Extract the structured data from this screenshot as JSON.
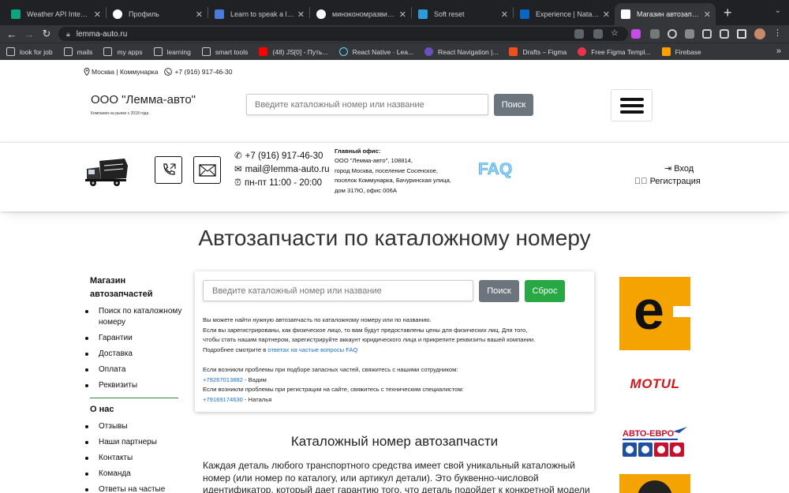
{
  "browser": {
    "tabs": [
      {
        "title": "Weather API Integratio",
        "color": "#10a37f"
      },
      {
        "title": "Профиль",
        "color": "#ffffff"
      },
      {
        "title": "Learn to speak a langu",
        "color": "#4a7bd8"
      },
      {
        "title": "минэкономразвития",
        "color": "#ffffff"
      },
      {
        "title": "Soft reset",
        "color": "#2d9bd9"
      },
      {
        "title": "Experience | Nataly Bi",
        "color": "#0a66c2"
      },
      {
        "title": "Магазин автозапчаст",
        "color": "#ffffff"
      }
    ],
    "url": "lemma-auto.ru",
    "bookmarks": [
      {
        "label": "look for job",
        "icon": "folder-icon"
      },
      {
        "label": "mails",
        "icon": "folder-icon"
      },
      {
        "label": "my apps",
        "icon": "folder-icon"
      },
      {
        "label": "learning",
        "icon": "folder-icon"
      },
      {
        "label": "smart tools",
        "icon": "folder-icon"
      },
      {
        "label": "(48) JS[0] - Путь...",
        "icon": "youtube-icon"
      },
      {
        "label": "React Native · Lea...",
        "icon": "react-icon"
      },
      {
        "label": "React Navigation |...",
        "icon": "react-navigation-icon"
      },
      {
        "label": "Drafts – Figma",
        "icon": "figma-icon"
      },
      {
        "label": "Free Figma Templ...",
        "icon": "figma-icon"
      },
      {
        "label": "Firebase",
        "icon": "firebase-icon"
      }
    ]
  },
  "header": {
    "location": "Москва | Коммунарка",
    "phone": "+7 (916) 917-46-30",
    "company": "ООО \"Лемма-авто\"",
    "company_sub": "Компания на рынке с 2018 года",
    "search_placeholder": "Введите каталожный номер или название",
    "search_button": "Поиск"
  },
  "contacts": {
    "phone": "+7 (916) 917-46-30",
    "email": "mail@lemma-auto.ru",
    "hours": "пн-пт 11:00 - 20:00",
    "office_title": "Главный офис:",
    "office_lines": [
      "ООО \"Лемма-авто\", 108814,",
      "город Москва, поселение Сосенское,",
      "поселок Коммунарка, Бачуринская улица,",
      "дом 317Ю, офис 006А"
    ],
    "faq": "FAQ",
    "login": "Вход",
    "register": "Регистрация"
  },
  "page": {
    "title": "Автозапчасти по каталожному номеру",
    "search_placeholder": "Введите каталожный номер или название",
    "search_button": "Поиск",
    "reset_button": "Сброс",
    "info": {
      "line1": "Вы можете найти нужную автозапчасть по каталожному номеру или по названию.",
      "line2": "Если вы зарегистрированы, как физическое лицо, то вам будут предоставлены цены для физических лиц. Для того,",
      "line3": "чтобы стать нашим партнером, зарегистрируйте аккаунт юридического лица и прикрепите реквизиты вашей компании.",
      "line4_prefix": "Подробнее смотрите в ",
      "line4_link": "ответах на частые вопросы FAQ",
      "line5": "Если возникли проблемы при подборе запасных частей, свяжитесь с нашими сотрудником:",
      "phone1": "+79267013882",
      "phone1_name": " - Вадим",
      "line6": "Если возникли проблемы при регистрации на сайте, свяжитесь с техническим специалистом:",
      "phone2": "+79169174630",
      "phone2_name": " - Наталья"
    },
    "section_title": "Каталожный номер автозапчасти",
    "paragraph": "Каждая деталь любого транспортного средства имеет свой уникальный каталожный номер (или номер по каталогу, или артикул детали). Это буквенно-числовой идентификатор, который дает гарантию того, что деталь подойдет к конкретной модели автомобиля."
  },
  "sidebar": {
    "shop_title": "Магазин автозапчастей",
    "shop_items": [
      "Поиск по каталожному номеру",
      "Гарантии",
      "Доставка",
      "Оплата",
      "Реквизиты"
    ],
    "about_title": "О нас",
    "about_items": [
      "Отзывы",
      "Наши партнеры",
      "Контакты",
      "Команда",
      "Ответы на частые"
    ]
  },
  "brands": {
    "e_letter": "e",
    "motul": "MOTUL",
    "avtoevro": "АВТО-ЕВРО"
  },
  "colors": {
    "accent_green": "#28a745",
    "grey_button": "#6c757d",
    "brand_orange": "#f5a300",
    "link": "#1a6fd6"
  }
}
